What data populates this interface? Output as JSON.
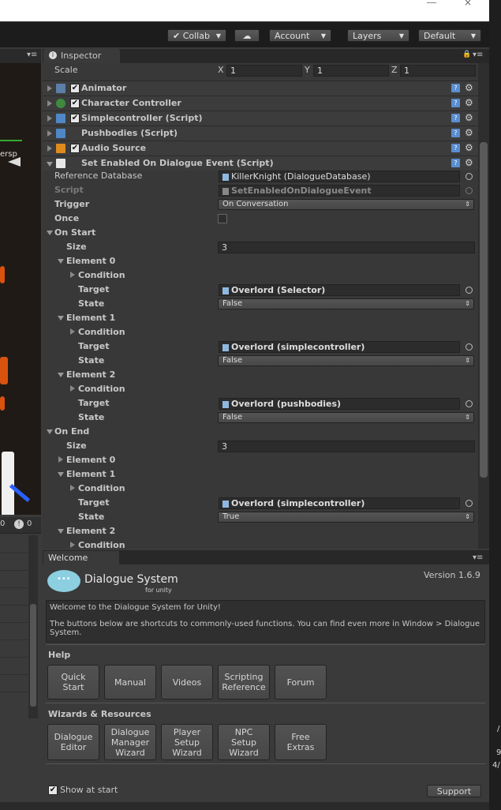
{
  "toolbar": {
    "collab": "Collab",
    "account": "Account",
    "layers": "Layers",
    "layout": "Default"
  },
  "scene": {
    "persp": "ersp"
  },
  "hierarchy": {
    "count_a": "0",
    "count_b": "0"
  },
  "inspector": {
    "tab": "Inspector",
    "scale_label": "Scale",
    "scale": {
      "x_label": "X",
      "x": "1",
      "y_label": "Y",
      "y": "1",
      "z_label": "Z",
      "z": "1"
    },
    "components": [
      {
        "name": "Animator"
      },
      {
        "name": "Character Controller"
      },
      {
        "name": "Simplecontroller (Script)"
      },
      {
        "name": "Pushbodies (Script)"
      },
      {
        "name": "Audio Source"
      },
      {
        "name": "Set Enabled On Dialogue Event (Script)"
      }
    ],
    "props": {
      "ref_db_label": "Reference Database",
      "ref_db_value": "KillerKnight (DialogueDatabase)",
      "script_label": "Script",
      "script_value": "SetEnabledOnDialogueEvent",
      "trigger_label": "Trigger",
      "trigger_value": "On Conversation",
      "once_label": "Once",
      "on_start": "On Start",
      "size_label": "Size",
      "start_size": "3",
      "element0": "Element 0",
      "element1": "Element 1",
      "element2": "Element 2",
      "condition": "Condition",
      "target_label": "Target",
      "state_label": "State",
      "start_e0_target": "Overlord (Selector)",
      "start_e0_state": "False",
      "start_e1_target": "Overlord (simplecontroller)",
      "start_e1_state": "False",
      "start_e2_target": "Overlord (pushbodies)",
      "start_e2_state": "False",
      "on_end": "On End",
      "end_size": "3",
      "end_e1_target": "Overlord (simplecontroller)",
      "end_e1_state": "True"
    }
  },
  "welcome": {
    "tab": "Welcome",
    "logo_title": "Dialogue System",
    "logo_sub": "for unity",
    "version": "Version 1.6.9",
    "intro1": "Welcome to the Dialogue System for Unity!",
    "intro2": "The buttons below are shortcuts to commonly-used functions. You can find even more in Window > Dialogue System.",
    "help_heading": "Help",
    "help_buttons": [
      "Quick\nStart",
      "Manual",
      "Videos",
      "Scripting\nReference",
      "Forum"
    ],
    "wizards_heading": "Wizards & Resources",
    "wizard_buttons": [
      "Dialogue\nEditor",
      "Dialogue\nManager\nWizard",
      "Player\nSetup\nWizard",
      "NPC\nSetup\nWizard",
      "Free\nExtras"
    ],
    "show_at_start": "Show at start",
    "support": "Support"
  },
  "edge": {
    "line1": "/",
    "line2": "9",
    "line3": "4/"
  }
}
